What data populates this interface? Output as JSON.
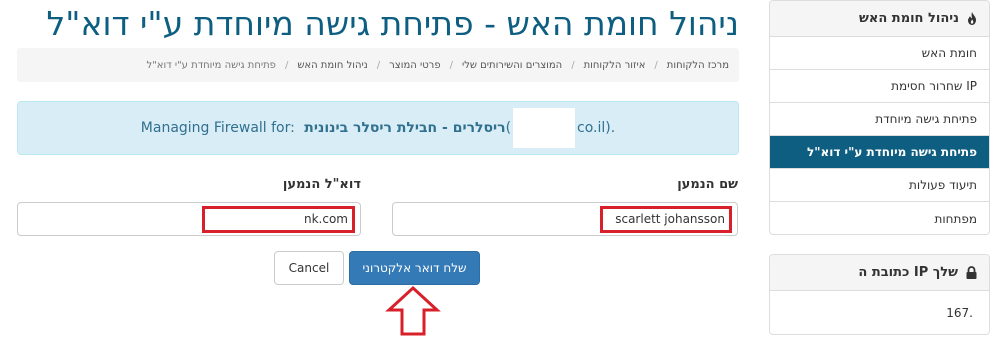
{
  "page": {
    "title": "ניהול חומת האש - פתיחת גישה מיוחדת ע\"י דוא\"ל"
  },
  "breadcrumb": [
    "מרכז הלקוחות",
    "איזור הלקוחות",
    "המוצרים והשירותים שלי",
    "פרטי המוצר",
    "ניהול חומת האש",
    "פתיחת גישה מיוחדת ע\"י דוא\"ל"
  ],
  "info": {
    "prefix": "Managing Firewall for:",
    "product": "ריסלרים - חבילת ריסלר בינונית",
    "paren_open": "(",
    "domain_suffix": "co.il)."
  },
  "form": {
    "name_label": "שם הנמען",
    "name_value": "scarlett johansson",
    "email_label": "דוא\"ל הנמען",
    "email_value": "nk.com"
  },
  "buttons": {
    "send": "שלח דואר אלקטרוני",
    "cancel": "Cancel"
  },
  "sidebar": {
    "firewall_title": "ניהול חומת האש",
    "firewall_icon": "fire-icon",
    "items": [
      {
        "label": "חומת האש"
      },
      {
        "label": "שחרור חסימת IP"
      },
      {
        "label": "פתיחת גישה מיוחדת"
      },
      {
        "label": "פתיחת גישה מיוחדת ע\"י דוא\"ל",
        "active": true
      },
      {
        "label": "תיעוד פעולות"
      },
      {
        "label": "מפתחות"
      }
    ],
    "ip_title": "כתובת ה IP שלך",
    "ip_icon": "lock-icon",
    "ip_value": "167."
  },
  "colors": {
    "brand": "#0d5e80",
    "primary_button": "#337ab7",
    "annotation_red": "#d8202a",
    "info_bg": "#d9edf7"
  }
}
